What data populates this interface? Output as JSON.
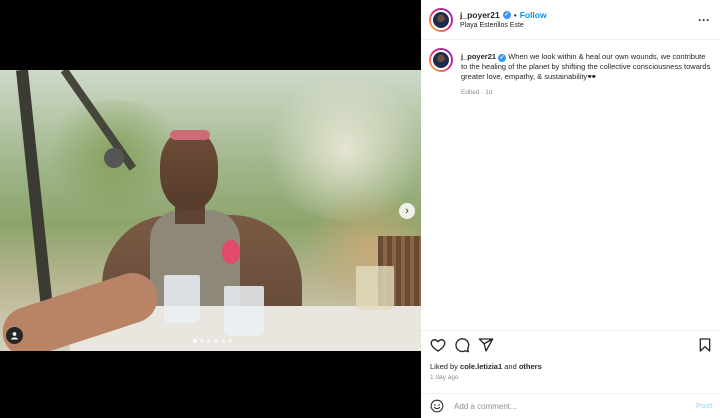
{
  "post": {
    "username": "j_poyer21",
    "separator": "•",
    "follow_label": "Follow",
    "location": "Playa Esterillos Este",
    "more_label": "···"
  },
  "caption": {
    "username": "j_poyer21",
    "text": "When we look within & heal our own wounds, we contribute to the healing of the planet by shifting the collective consciousness towards greater love, empathy, & sustainability🕶️",
    "edited": "Edited",
    "dot": "·",
    "age": "1d"
  },
  "media": {
    "carousel_total": 6,
    "carousel_index": 0,
    "next_label": "›"
  },
  "engagement": {
    "liked_by_prefix": "Liked by",
    "liked_by_user": "cole.letizia1",
    "liked_by_and": "and",
    "liked_by_others": "others",
    "time_ago": "1 day ago"
  },
  "comment_box": {
    "placeholder": "Add a comment...",
    "post_label": "Post"
  },
  "colors": {
    "accent": "#0095f6",
    "verified": "#3897f0",
    "muted": "#8e8e8e",
    "post_disabled": "#b2dffc"
  },
  "icons": [
    "heart-icon",
    "comment-icon",
    "share-icon",
    "bookmark-icon",
    "emoji-icon",
    "verified-icon",
    "more-icon",
    "chevron-right-icon",
    "user-tag-icon"
  ]
}
